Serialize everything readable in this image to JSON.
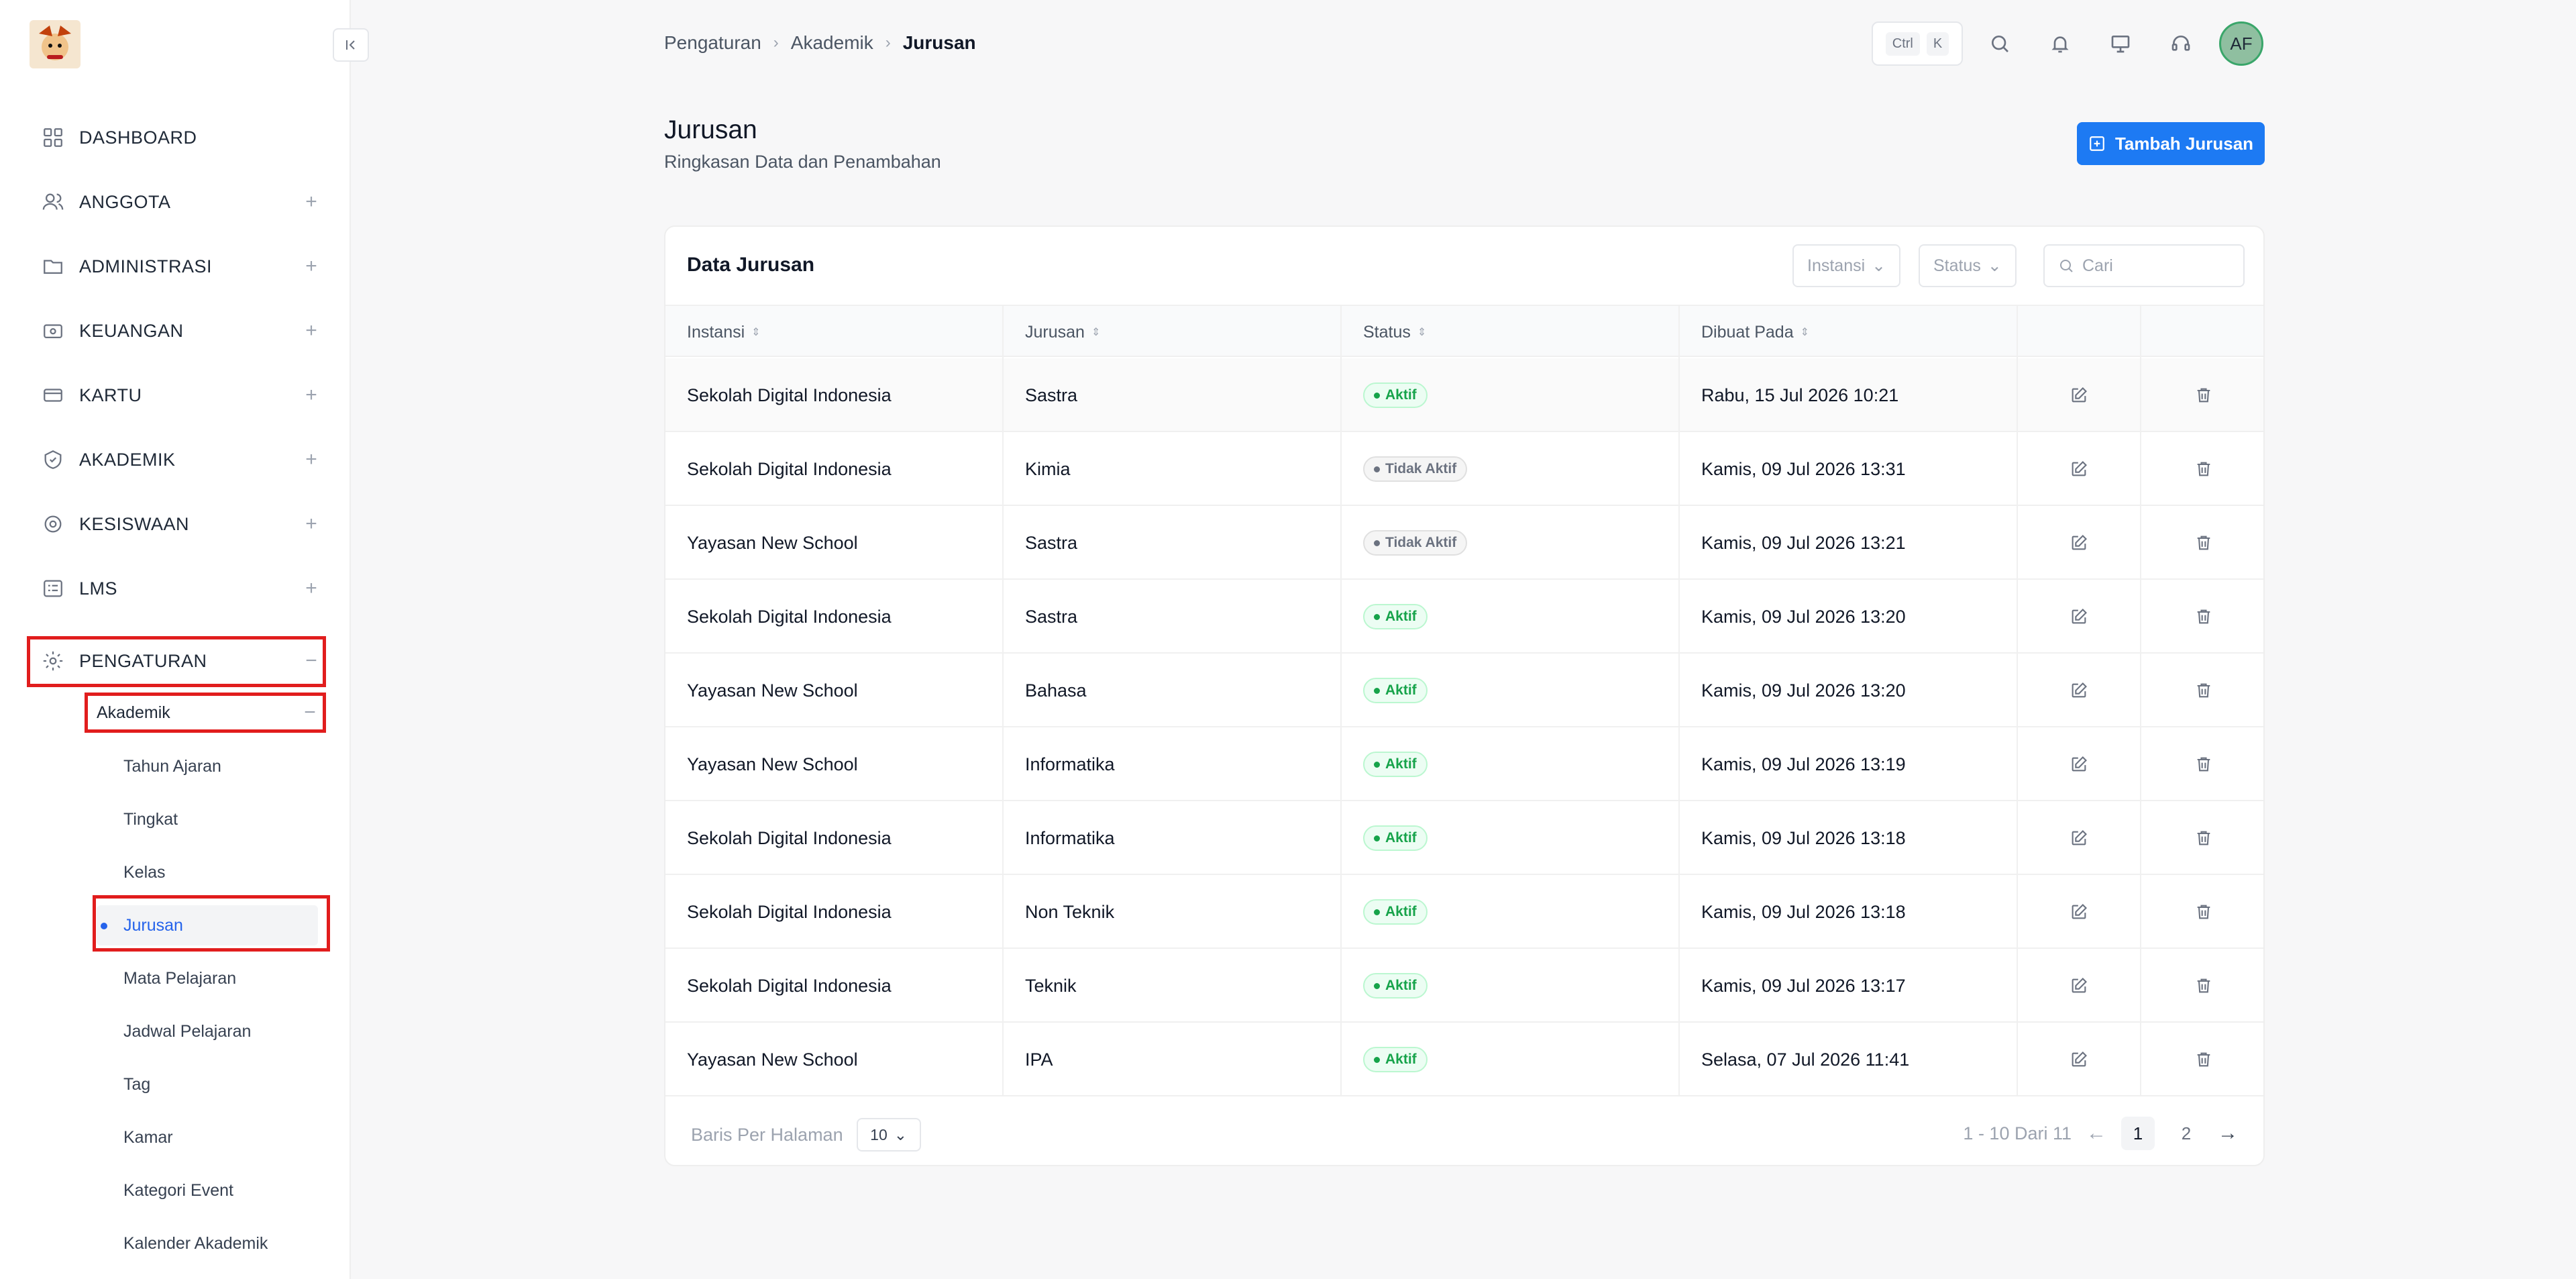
{
  "sidebar": {
    "menu": [
      {
        "label": "DASHBOARD",
        "icon": "grid-icon",
        "expand": ""
      },
      {
        "label": "ANGGOTA",
        "icon": "users-icon",
        "expand": "+"
      },
      {
        "label": "ADMINISTRASI",
        "icon": "folder-icon",
        "expand": "+"
      },
      {
        "label": "KEUANGAN",
        "icon": "wallet-icon",
        "expand": "+"
      },
      {
        "label": "KARTU",
        "icon": "card-icon",
        "expand": "+"
      },
      {
        "label": "AKADEMIK",
        "icon": "academic-icon",
        "expand": "+"
      },
      {
        "label": "KESISWAAN",
        "icon": "student-icon",
        "expand": "+"
      },
      {
        "label": "LMS",
        "icon": "lms-icon",
        "expand": "+"
      },
      {
        "label": "PENGATURAN",
        "icon": "gear-icon",
        "expand": "−"
      }
    ],
    "submenu_head": {
      "label": "Akademik",
      "expand": "−"
    },
    "submenu": [
      {
        "label": "Tahun Ajaran"
      },
      {
        "label": "Tingkat"
      },
      {
        "label": "Kelas"
      },
      {
        "label": "Jurusan"
      },
      {
        "label": "Mata Pelajaran"
      },
      {
        "label": "Jadwal Pelajaran"
      },
      {
        "label": "Tag"
      },
      {
        "label": "Kamar"
      },
      {
        "label": "Kategori Event"
      },
      {
        "label": "Kalender Akademik"
      }
    ]
  },
  "header": {
    "breadcrumb": [
      "Pengaturan",
      "Akademik",
      "Jurusan"
    ],
    "kbd": [
      "Ctrl",
      "K"
    ],
    "avatar": "AF"
  },
  "page": {
    "title": "Jurusan",
    "subtitle": "Ringkasan Data dan Penambahan",
    "add_button": "Tambah Jurusan"
  },
  "table": {
    "title": "Data Jurusan",
    "filters": [
      "Instansi",
      "Status"
    ],
    "search_placeholder": "Cari",
    "columns": [
      "Instansi",
      "Jurusan",
      "Status",
      "Dibuat Pada"
    ],
    "rows": [
      {
        "instansi": "Sekolah Digital Indonesia",
        "jurusan": "Sastra",
        "status": "Aktif",
        "dibuat": "Rabu, 15 Jul 2026 10:21"
      },
      {
        "instansi": "Sekolah Digital Indonesia",
        "jurusan": "Kimia",
        "status": "Tidak Aktif",
        "dibuat": "Kamis, 09 Jul 2026 13:31"
      },
      {
        "instansi": "Yayasan New School",
        "jurusan": "Sastra",
        "status": "Tidak Aktif",
        "dibuat": "Kamis, 09 Jul 2026 13:21"
      },
      {
        "instansi": "Sekolah Digital Indonesia",
        "jurusan": "Sastra",
        "status": "Aktif",
        "dibuat": "Kamis, 09 Jul 2026 13:20"
      },
      {
        "instansi": "Yayasan New School",
        "jurusan": "Bahasa",
        "status": "Aktif",
        "dibuat": "Kamis, 09 Jul 2026 13:20"
      },
      {
        "instansi": "Yayasan New School",
        "jurusan": "Informatika",
        "status": "Aktif",
        "dibuat": "Kamis, 09 Jul 2026 13:19"
      },
      {
        "instansi": "Sekolah Digital Indonesia",
        "jurusan": "Informatika",
        "status": "Aktif",
        "dibuat": "Kamis, 09 Jul 2026 13:18"
      },
      {
        "instansi": "Sekolah Digital Indonesia",
        "jurusan": "Non Teknik",
        "status": "Aktif",
        "dibuat": "Kamis, 09 Jul 2026 13:18"
      },
      {
        "instansi": "Sekolah Digital Indonesia",
        "jurusan": "Teknik",
        "status": "Aktif",
        "dibuat": "Kamis, 09 Jul 2026 13:17"
      },
      {
        "instansi": "Yayasan New School",
        "jurusan": "IPA",
        "status": "Aktif",
        "dibuat": "Selasa, 07 Jul 2026 11:41"
      }
    ],
    "rows_per_page_label": "Baris Per Halaman",
    "rows_per_page": "10",
    "range": "1 - 10 Dari 11",
    "pages": [
      "1",
      "2"
    ]
  },
  "colors": {
    "accent": "#1d7af3",
    "active_green": "#16a34a",
    "highlight_red": "#e11d1d"
  }
}
